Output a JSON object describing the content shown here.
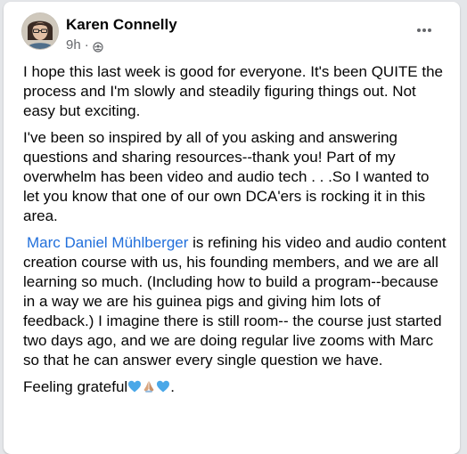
{
  "post": {
    "author": "Karen Connelly",
    "time": "9h",
    "dot": "·",
    "privacy_icon": "group-icon",
    "more_icon": "more-horizontal-icon",
    "paragraphs": [
      "I hope this last week is good for everyone. It's been QUITE the process and I'm slowly and steadily figuring things out. Not easy but exciting.",
      "I've been so inspired by all of you asking and answering questions and sharing resources--thank you! Part of my overwhelm has been video and audio tech . . .So I wanted to let you know that one of our own DCA'ers is rocking it in this area."
    ],
    "mention": "Marc Daniel Mühlberger",
    "mention_paragraph_rest": " is refining his video and audio content creation course with us, his founding members, and we are all learning so much. (Including how to build a program--because in a way we are his guinea pigs and giving him lots of feedback.) I imagine there is still room-- the course just started two days ago, and we are doing regular live zooms with Marc so that he can answer every single question we have.",
    "closing_text": "Feeling grateful",
    "closing_end": ".",
    "closing_emojis": [
      "blue-heart-icon",
      "folded-hands-icon",
      "blue-heart-icon"
    ],
    "colors": {
      "link": "#216fdb",
      "secondary_text": "#65676b",
      "heart": "#4aa8e8"
    }
  }
}
